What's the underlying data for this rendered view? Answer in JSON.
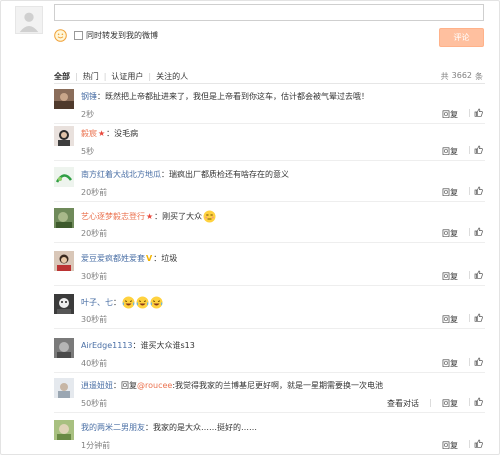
{
  "composer": {
    "input_value": "",
    "repost_label": "同时转发到我的微博",
    "submit_label": "评论"
  },
  "filters": {
    "tabs": [
      "全部",
      "热门",
      "认证用户",
      "关注的人"
    ],
    "count_prefix": "共",
    "count_value": "3662",
    "count_suffix": "条"
  },
  "actions": {
    "reply": "回复",
    "like_icon": "thumbs-up-icon",
    "view_conversation": "查看对话"
  },
  "comments": [
    {
      "user": "钢锤",
      "sep": "：",
      "text": "既然把上帝都扯进来了，我但是上帝看到你这车，估计都会被气晕过去哦！",
      "time": "2秒"
    },
    {
      "user": "毅宸",
      "badge": "★",
      "sep": "：",
      "text": "没毛病",
      "time": "5秒"
    },
    {
      "user": "南方红着大战北方地瓜",
      "sep": "：",
      "text": "瑞疯出厂都质检还有啥存在的意义",
      "time": "20秒前"
    },
    {
      "user": "艺心逐梦毅志登行",
      "badge": "★",
      "sep": "：",
      "text": "刚买了大众",
      "emoji": "embarrassed-face",
      "time": "20秒前"
    },
    {
      "user": "爱豆爱疯都姓爱套",
      "badge": "V",
      "sep": "：",
      "text": "垃圾",
      "time": "30秒前"
    },
    {
      "user": "叶子、七",
      "sep": "：",
      "text": "",
      "emoji": "laughing-face x3",
      "time": "30秒前"
    },
    {
      "user": "AirEdge1113",
      "sep": "：",
      "text": "谁买大众谁s13",
      "time": "40秒前"
    },
    {
      "user": "逍遥妞妞",
      "sep": "：",
      "text_before": "回复",
      "mention": "@roucee",
      "text": ":我觉得我家的兰博基尼更好啊，就是一星期需要换一次电池",
      "time": "50秒前"
    },
    {
      "user": "我的两米二男朋友",
      "sep": "：",
      "text": "我家的是大众……挺好的……",
      "time": "1分钟前"
    }
  ]
}
